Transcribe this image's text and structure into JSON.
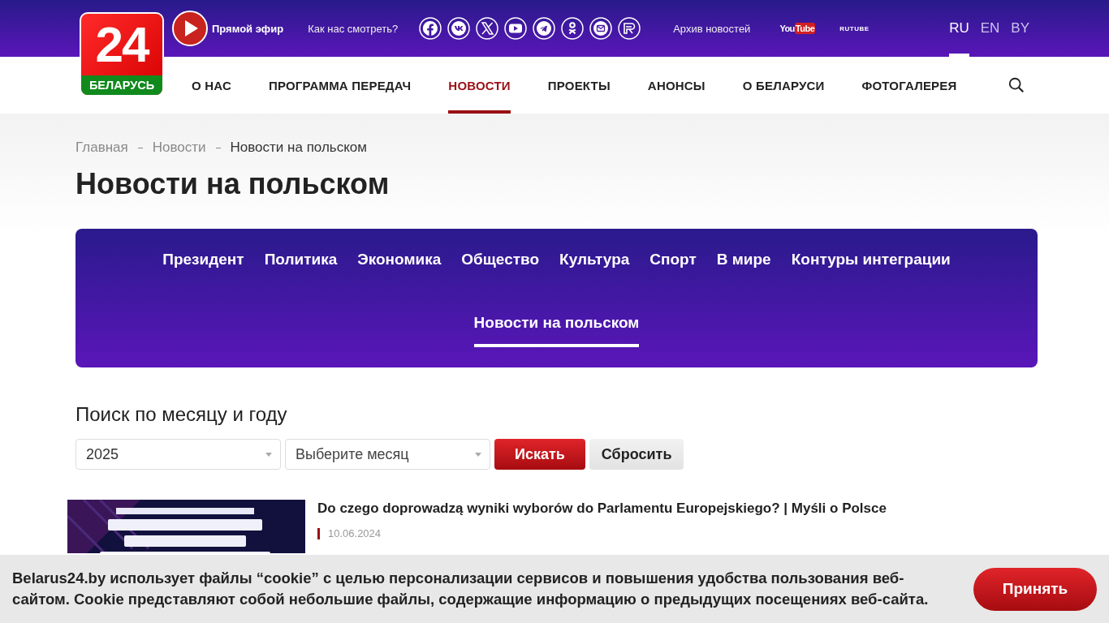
{
  "logo": {
    "number": "24",
    "name": "БЕЛАРУСЬ"
  },
  "top_bar": {
    "live": "Прямой эфир",
    "how_to_watch": "Как нас смотреть?",
    "social": [
      {
        "kind": "facebook"
      },
      {
        "kind": "vk"
      },
      {
        "kind": "x"
      },
      {
        "kind": "youtube"
      },
      {
        "kind": "telegram"
      },
      {
        "kind": "ok"
      },
      {
        "kind": "mail"
      },
      {
        "kind": "rutube"
      }
    ],
    "archive": "Архив новостей",
    "youtube_logo": [
      "You",
      "Tube"
    ],
    "rutube_logo": "RUTUBE",
    "languages": [
      {
        "label": "RU",
        "selected": true
      },
      {
        "label": "EN",
        "selected": false
      },
      {
        "label": "BY",
        "selected": false
      }
    ]
  },
  "main_nav": [
    {
      "label": "О НАС",
      "selected": false
    },
    {
      "label": "ПРОГРАММА ПЕРЕДАЧ",
      "selected": false
    },
    {
      "label": "НОВОСТИ",
      "selected": true
    },
    {
      "label": "ПРОЕКТЫ",
      "selected": false
    },
    {
      "label": "АНОНСЫ",
      "selected": false
    },
    {
      "label": "О БЕЛАРУСИ",
      "selected": false
    },
    {
      "label": "ФОТОГАЛЕРЕЯ",
      "selected": false
    }
  ],
  "breadcrumbs": [
    "Главная",
    "Новости",
    "Новости на польском"
  ],
  "page_title": "Новости на польском",
  "categories": [
    {
      "label": "Президент",
      "selected": false
    },
    {
      "label": "Политика",
      "selected": false
    },
    {
      "label": "Экономика",
      "selected": false
    },
    {
      "label": "Общество",
      "selected": false
    },
    {
      "label": "Культура",
      "selected": false
    },
    {
      "label": "Спорт",
      "selected": false
    },
    {
      "label": "В мире",
      "selected": false
    },
    {
      "label": "Контуры интеграции",
      "selected": false
    },
    {
      "label": "Новости на польском",
      "selected": true
    }
  ],
  "search": {
    "title": "Поиск по месяцу и году",
    "year": "2025",
    "month_placeholder": "Выберите месяц",
    "submit": "Искать",
    "reset": "Сбросить"
  },
  "articles": [
    {
      "title": "Do czego doprowadzą wyniki wyborów do Parlamentu Europejskiego? | Myśli o Polsce",
      "date": "10.06.2024"
    }
  ],
  "cookie": {
    "text": "Belarus24.by использует файлы “cookie” с целью персонализации сервисов и повышения удобства пользования веб-сайтом. Cookie представляют собой небольшие файлы, содержащие информацию о предыдущих посещениях веб-сайта.",
    "accept": "Принять"
  }
}
